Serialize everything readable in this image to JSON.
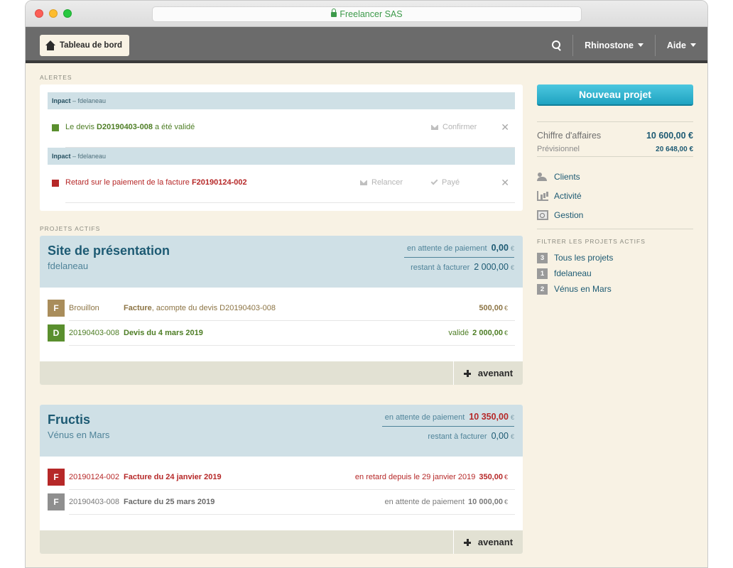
{
  "browser": {
    "url_title": "Freelancer SAS"
  },
  "appbar": {
    "home_label": "Tableau de bord",
    "user_menu": "Rhinostone",
    "help_menu": "Aide"
  },
  "alerts": {
    "section_label": "ALERTES",
    "items": [
      {
        "head_bold": "Inpact",
        "head_rest": " – fdelaneau",
        "text_prefix": "Le devis ",
        "text_ref": "D20190403-008",
        "text_suffix": " a été validé",
        "status_color": "#5a8f2e",
        "action1": "Confirmer"
      },
      {
        "head_bold": "Inpact",
        "head_rest": " – fdelaneau",
        "text_prefix": "Retard sur le paiement de la facture ",
        "text_ref": "F20190124-002",
        "text_suffix": "",
        "status_color": "#b62828",
        "action1": "Relancer",
        "action2": "Payé"
      }
    ]
  },
  "projects_section_label": "PROJETS ACTIFS",
  "projects": [
    {
      "title": "Site de présentation",
      "client": "fdelaneau",
      "pending_label": "en attente de paiement",
      "pending_amount": "0,00",
      "remaining_label": "restant à facturer",
      "remaining_amount": "2 000,00",
      "currency": "€",
      "docs": [
        {
          "badge": "F",
          "badge_color": "#a98d5b",
          "num": "Brouillon",
          "label_bold": "Facture",
          "label_rest": ", acompte du devis D20190403-008",
          "status": "",
          "amount": "500,00",
          "currency": "€",
          "color": "#8c7444"
        },
        {
          "badge": "D",
          "badge_color": "#5a8f2e",
          "num": "20190403-008",
          "label_bold": "Devis du 4 mars 2019",
          "label_rest": "",
          "status": "validé",
          "amount": "2 000,00",
          "currency": "€",
          "color": "#4d7d24"
        }
      ],
      "amendment_label": "avenant"
    },
    {
      "title": "Fructis",
      "client": "Vénus en Mars",
      "pending_label": "en attente de paiement",
      "pending_amount": "10 350,00",
      "remaining_label": "restant à facturer",
      "remaining_amount": "0,00",
      "currency": "€",
      "docs": [
        {
          "badge": "F",
          "badge_color": "#b62828",
          "num": "20190124-002",
          "label_bold": "Facture du 24 janvier 2019",
          "label_rest": "",
          "status": "en retard depuis le 29 janvier 2019",
          "amount": "350,00",
          "currency": "€",
          "color": "#b62828"
        },
        {
          "badge": "F",
          "badge_color": "#8f8f8f",
          "num": "20190403-008",
          "label_bold": "Facture du 25 mars 2019",
          "label_rest": "",
          "status": "en attente de paiement",
          "amount": "10 000,00",
          "currency": "€",
          "color": "#7a7a7a"
        }
      ],
      "amendment_label": "avenant"
    }
  ],
  "sidebar": {
    "new_project": "Nouveau projet",
    "revenue_label": "Chiffre d'affaires",
    "revenue_value": "10 600,00 €",
    "forecast_label": "Prévisionnel",
    "forecast_value": "20 648,00 €",
    "links": [
      {
        "label": "Clients",
        "icon": "clients-icon"
      },
      {
        "label": "Activité",
        "icon": "activity-chart-icon"
      },
      {
        "label": "Gestion",
        "icon": "management-icon"
      }
    ],
    "filter_label": "FILTRER LES PROJETS ACTIFS",
    "filters": [
      {
        "count": "3",
        "label": "Tous les projets"
      },
      {
        "count": "1",
        "label": "fdelaneau"
      },
      {
        "count": "2",
        "label": "Vénus en Mars"
      }
    ]
  }
}
